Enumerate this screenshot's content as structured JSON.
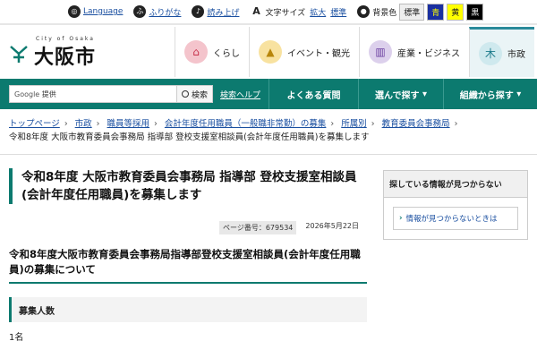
{
  "utility": {
    "language": "Language",
    "furigana": "ふりがな",
    "read_aloud": "読み上げ",
    "font_size_label": "文字サイズ",
    "font_enlarge": "拡大",
    "font_standard": "標準",
    "bg_color_label": "背景色",
    "bg_standard": "標準",
    "bg_blue": "青",
    "bg_yellow": "黄",
    "bg_black": "黒"
  },
  "header": {
    "logo_small": "City of Osaka",
    "logo_text": "大阪市",
    "nav": [
      {
        "label": "くらし",
        "icon": "house-icon"
      },
      {
        "label": "イベント・観光",
        "icon": "event-icon"
      },
      {
        "label": "産業・ビジネス",
        "icon": "building-icon"
      },
      {
        "label": "市政",
        "icon": "city-mark-icon"
      }
    ]
  },
  "search": {
    "google_label": "Google",
    "placeholder": "提供",
    "button_label": "検索",
    "help_link": "検索ヘルプ"
  },
  "main_nav": {
    "faq": "よくある質問",
    "choose": "選んで探す",
    "org": "組織から探す"
  },
  "breadcrumb": {
    "items": [
      "トップページ",
      "市政",
      "職員等採用",
      "会計年度任用職員（一般職非常勤）の募集",
      "所属別",
      "教育委員会事務局"
    ],
    "current": "令和8年度 大阪市教育委員会事務局 指導部 登校支援室相談員(会計年度任用職員)を募集します"
  },
  "page": {
    "title": "令和8年度 大阪市教育委員会事務局 指導部 登校支援室相談員(会計年度任用職員)を募集します",
    "page_number": "ページ番号：679534",
    "date": "2026年5月22日",
    "subtitle": "令和8年度大阪市教育委員会事務局指導部登校支援室相談員(会計年度任用職員)の募集について",
    "section_heading": "募集人数",
    "section_body": "1名"
  },
  "sidebar": {
    "heading": "探している情報が見つからない",
    "link": "情報が見つからないときは"
  },
  "colors": {
    "brand_green": "#0c7a6f",
    "link_blue": "#1a4fa0"
  }
}
